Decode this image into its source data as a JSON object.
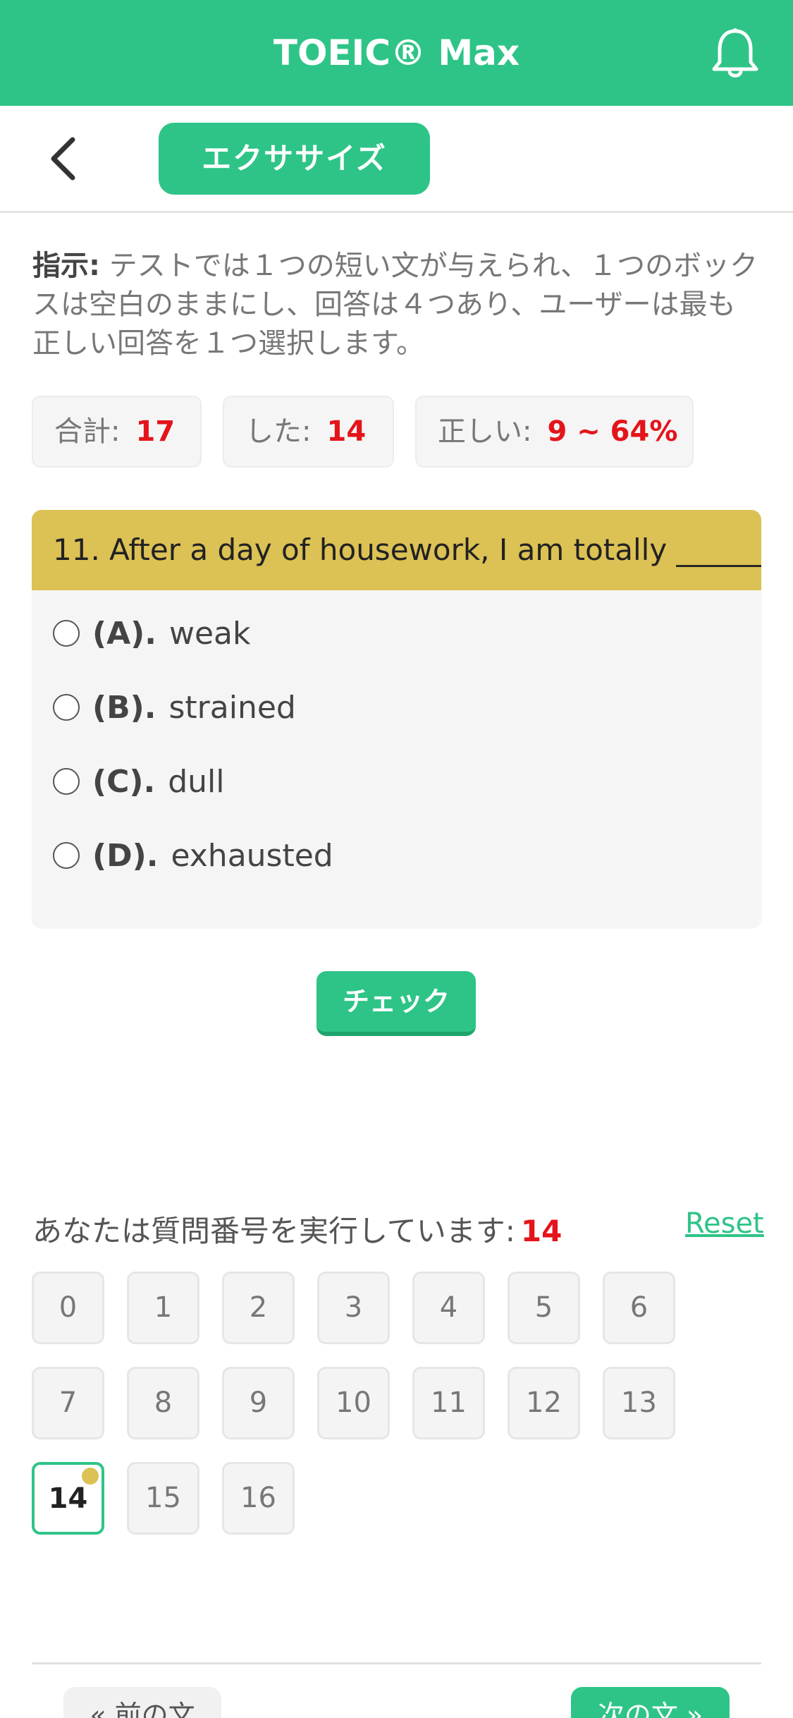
{
  "app": {
    "title": "TOEIC® Max"
  },
  "toolbar": {
    "tab_label": "エクササイズ"
  },
  "instructions": {
    "label": "指示:",
    "text": " テストでは１つの短い文が与えられ、１つのボックスは空白のままにし、回答は４つあり、ユーザーは最も正しい回答を１つ選択します。"
  },
  "stats": {
    "total": {
      "label": "合計:",
      "value": "17"
    },
    "done": {
      "label": "した:",
      "value": "14"
    },
    "correct": {
      "label": "正しい:",
      "value": "9 ~ 64%"
    }
  },
  "question": {
    "text": "11. After a day of housework, I am totally ______.",
    "options": [
      {
        "letter": "(A).",
        "text": "weak"
      },
      {
        "letter": "(B).",
        "text": "strained"
      },
      {
        "letter": "(C).",
        "text": "dull"
      },
      {
        "letter": "(D).",
        "text": "exhausted"
      }
    ]
  },
  "check_label": "チェック",
  "progress": {
    "label": "あなたは質問番号を実行しています:",
    "current": "14",
    "reset_label": "Reset",
    "numbers": [
      "0",
      "1",
      "2",
      "3",
      "4",
      "5",
      "6",
      "7",
      "8",
      "9",
      "10",
      "11",
      "12",
      "13",
      "14",
      "15",
      "16"
    ],
    "active_index": 14
  },
  "footer": {
    "prev_label": "« 前の文",
    "next_label": "次の文 »"
  },
  "colors": {
    "primary": "#2ec487",
    "question_header": "#dcc155",
    "highlight_red": "#e4141b"
  },
  "icons": {
    "bell": "bell-icon",
    "back": "chevron-left-icon"
  }
}
